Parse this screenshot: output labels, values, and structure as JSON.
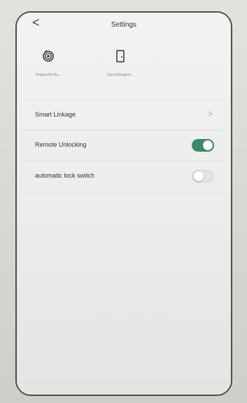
{
  "header": {
    "back_glyph": "<",
    "title": "Settings"
  },
  "quick_actions": [
    {
      "label": "Fingerprint Ma...",
      "icon": "fingerprint-icon"
    },
    {
      "label": "Card Managem...",
      "icon": "door-card-icon"
    }
  ],
  "settings": [
    {
      "label": "Smart Linkage",
      "type": "link",
      "chevron": ">"
    },
    {
      "label": "Remote Unlocking",
      "type": "toggle",
      "value": true
    },
    {
      "label": "automatic lock switch",
      "type": "toggle",
      "value": false
    }
  ],
  "colors": {
    "toggle_on": "#3a8a66",
    "toggle_off": "#e3e3e1",
    "text": "#333333"
  }
}
